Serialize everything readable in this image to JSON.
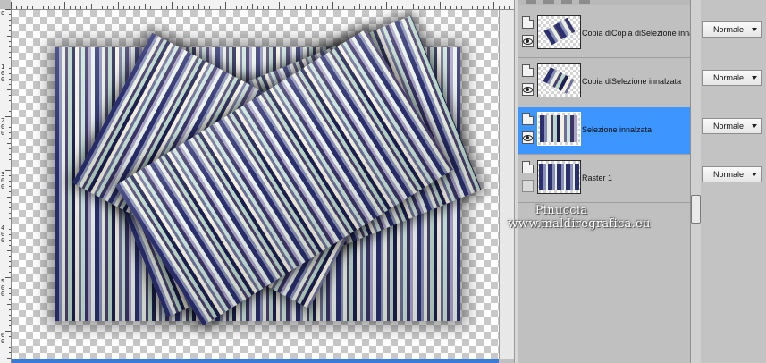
{
  "ruler_left": {
    "labels": [
      "0",
      "1\n0\n0",
      "2\n0\n0",
      "3\n0\n0",
      "4\n0\n0",
      "5\n0\n0",
      "6\n0"
    ]
  },
  "layers": [
    {
      "name": "Copia diCopia diSelezione innalzata",
      "visible": true,
      "selected": false,
      "blend_mode": "Normale"
    },
    {
      "name": "Copia diSelezione innalzata",
      "visible": true,
      "selected": false,
      "blend_mode": "Normale"
    },
    {
      "name": "Selezione innalzata",
      "visible": true,
      "selected": true,
      "blend_mode": "Normale"
    },
    {
      "name": "Raster 1",
      "visible": false,
      "selected": false,
      "blend_mode": "Normale"
    }
  ],
  "watermark": {
    "line1": "Pinuccia",
    "line2": "www.maldiregrafica.eu"
  },
  "colors": {
    "selection": "#3d95ff",
    "stripe_dark": "#2a2f6e",
    "stripe_light": "#e6efe0"
  },
  "icons": {
    "layer_type": "page-icon",
    "visibility": "eye-icon",
    "dropdown": "chevron-down-icon"
  }
}
